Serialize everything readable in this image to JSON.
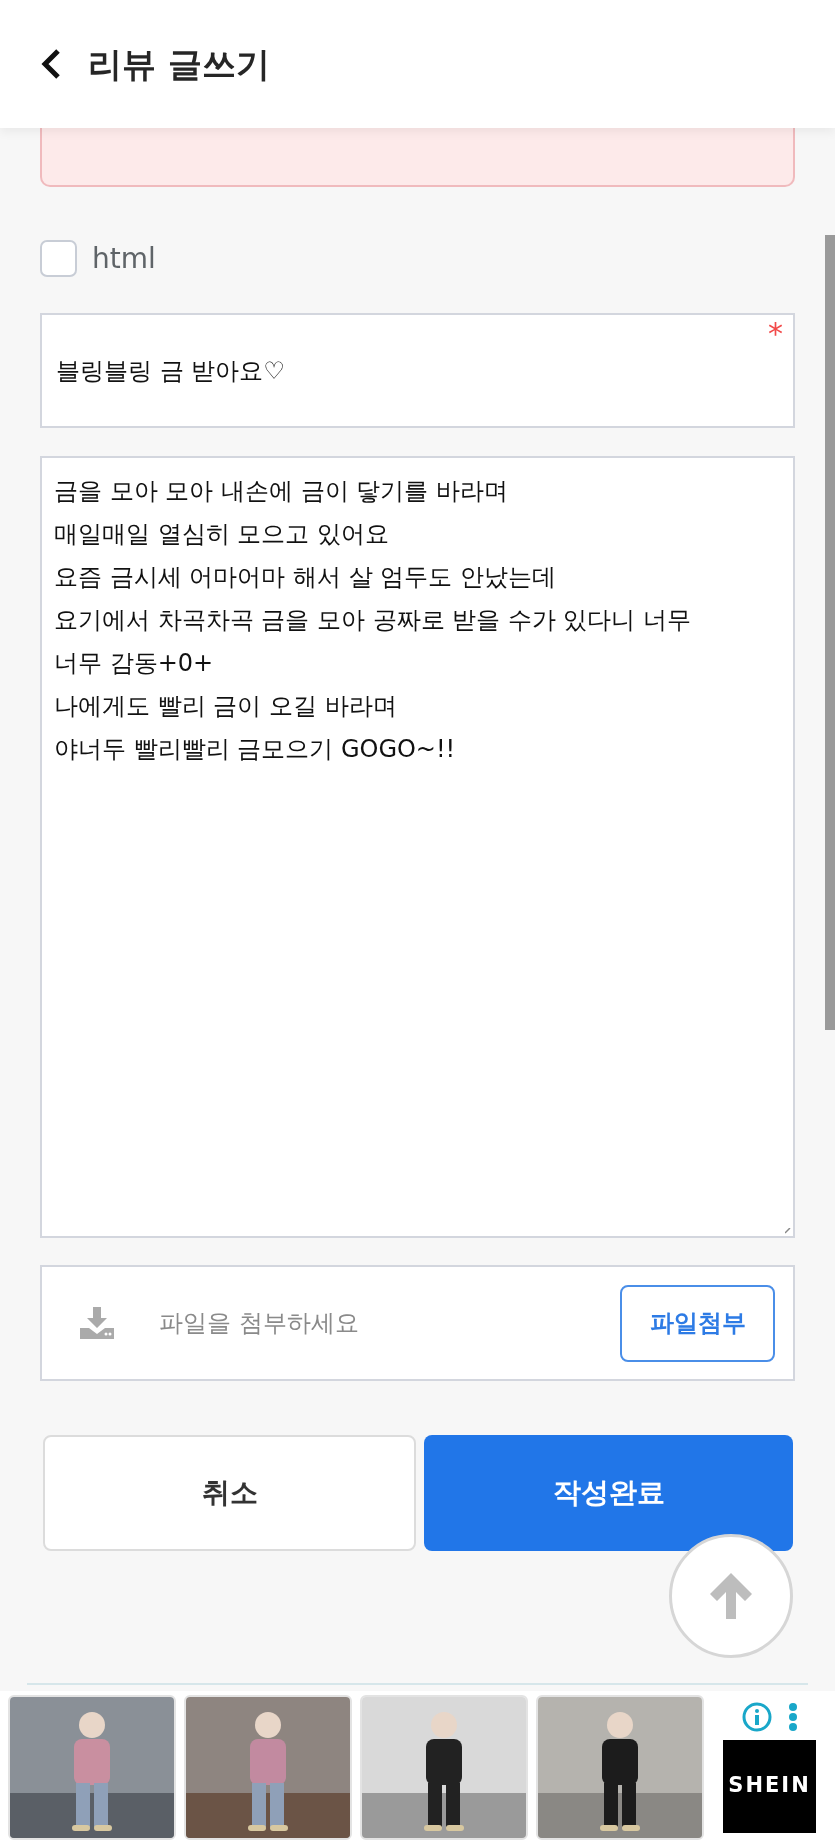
{
  "header": {
    "title": "리뷰 글쓰기"
  },
  "notice": {
    "kind": "alert"
  },
  "html_option": {
    "label": "html",
    "checked": false
  },
  "subject": {
    "value": "블링블링 금 받아요♡",
    "required_mark": "*"
  },
  "content": {
    "value": "금을 모아 모아 내손에 금이 닿기를 바라며\n매일매일 열심히 모으고 있어요\n요즘 금시세 어마어마 해서 살 엄두도 안났는데\n요기에서 차곡차곡 금을 모아 공짜로 받을 수가 있다니 너무\n너무 감동+0+\n나에게도 빨리 금이 오길 바라며\n야너두 빨리빨리 금모으기 GOGO~!!"
  },
  "attachment": {
    "placeholder": "파일을 첨부하세요",
    "button": "파일첨부"
  },
  "actions": [
    {
      "label": "취소",
      "kind": "secondary"
    },
    {
      "label": "작성완료",
      "kind": "primary"
    }
  ],
  "ad": {
    "brand": "SHEIN"
  }
}
